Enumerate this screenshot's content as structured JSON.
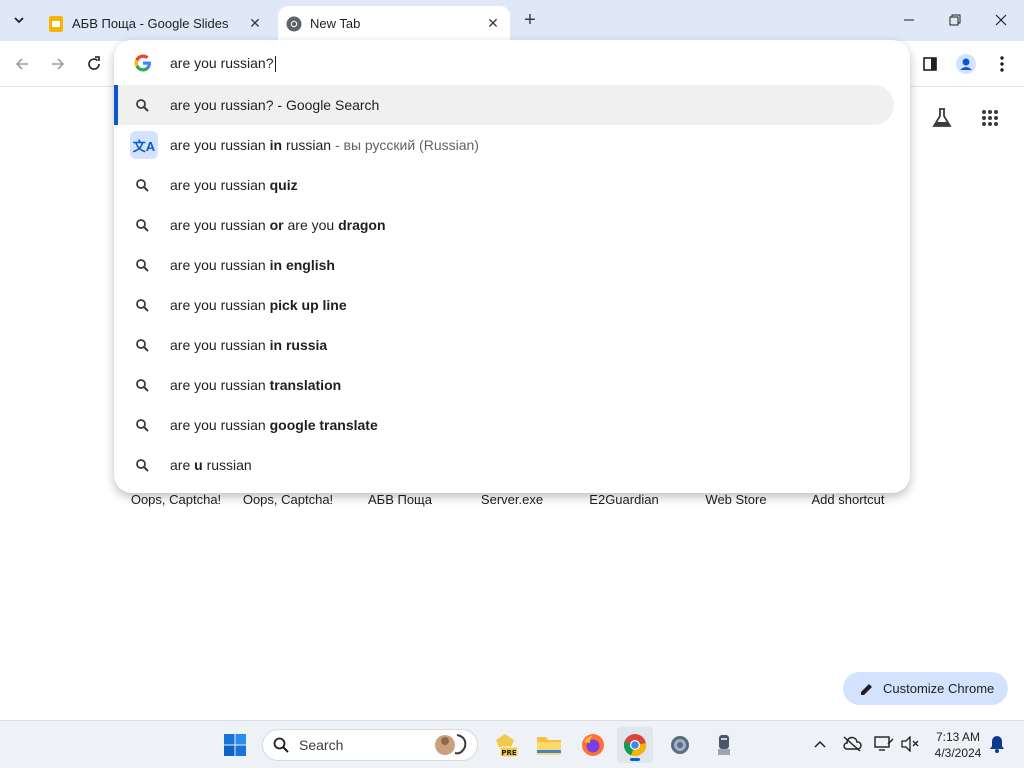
{
  "tabs": [
    {
      "title": "АБВ Поща - Google Slides",
      "close": "✕"
    },
    {
      "title": "New Tab",
      "close": "✕"
    }
  ],
  "new_tab_symbol": "+",
  "omnibox": {
    "query": "are you russian?",
    "suggestions": [
      {
        "plain": "are you russian? - Google Search",
        "bold": "",
        "tail": "",
        "icon": "search-icon"
      },
      {
        "plain": "are you russian ",
        "bold": "in",
        "tail": " russian",
        "dim": " - вы русский (Russian)",
        "icon": "translate-icon",
        "icon_text": "文A"
      },
      {
        "plain": "are you russian ",
        "bold": "quiz",
        "tail": "",
        "icon": "search-icon"
      },
      {
        "plain": "are you russian ",
        "bold": "or",
        "tail": " are you ",
        "bold2": "dragon",
        "icon": "search-icon"
      },
      {
        "plain": "are you russian ",
        "bold": "in english",
        "tail": "",
        "icon": "search-icon"
      },
      {
        "plain": "are you russian ",
        "bold": "pick up line",
        "tail": "",
        "icon": "search-icon"
      },
      {
        "plain": "are you russian ",
        "bold": "in russia",
        "tail": "",
        "icon": "search-icon"
      },
      {
        "plain": "are you russian ",
        "bold": "translation",
        "tail": "",
        "icon": "search-icon"
      },
      {
        "plain": "are you russian ",
        "bold": "google translate",
        "tail": "",
        "icon": "search-icon"
      },
      {
        "plain": "are ",
        "bold": "u",
        "tail": " russian",
        "icon": "search-icon"
      }
    ]
  },
  "shortcuts": [
    "Oops, Captcha!",
    "Oops, Captcha!",
    "АБВ Поща",
    "Server.exe",
    "E2Guardian",
    "Web Store",
    "Add shortcut"
  ],
  "customize_label": "Customize Chrome",
  "taskbar": {
    "search_label": "Search",
    "time": "7:13 AM",
    "date": "4/3/2024",
    "pre_badge": "PRE"
  },
  "colors": {
    "tabstrip": "#dfe8f7",
    "accent": "#0b57d0",
    "customize_bg": "#d3e3fd"
  }
}
